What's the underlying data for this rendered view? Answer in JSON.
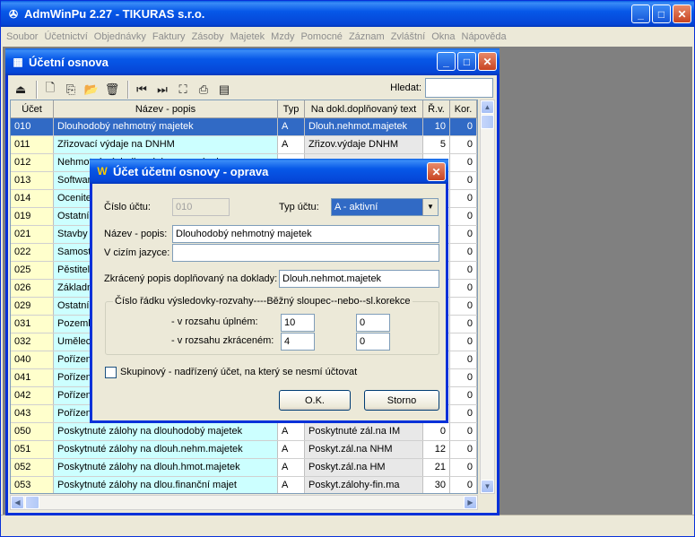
{
  "app": {
    "title": "AdmWinPu 2.27 - TIKURAS s.r.o.",
    "menu": [
      "Soubor",
      "Účetnictví",
      "Objednávky",
      "Faktury",
      "Zásoby",
      "Majetek",
      "Mzdy",
      "Pomocné",
      "Záznam",
      "Zvláštní",
      "Okna",
      "Nápověda"
    ]
  },
  "child": {
    "title": "Účetní osnova",
    "search_label": "Hledat:",
    "search_value": "",
    "columns": [
      "Účet",
      "Název - popis",
      "Typ",
      "Na dokl.doplňovaný text",
      "Ř.v.",
      "Kor."
    ],
    "rows": [
      {
        "ucet": "010",
        "nazev": "Dlouhodobý nehmotný majetek",
        "typ": "A",
        "text": "Dlouh.nehmot.majetek",
        "rv": "10",
        "kor": "0"
      },
      {
        "ucet": "011",
        "nazev": "Zřizovací výdaje na DNHM",
        "typ": "A",
        "text": "Zřizov.výdaje DNHM",
        "rv": "5",
        "kor": "0"
      },
      {
        "ucet": "012",
        "nazev": "Nehmotné výsledky výzkumu a vývoje",
        "typ": "",
        "text": "",
        "rv": "",
        "kor": "0"
      },
      {
        "ucet": "013",
        "nazev": "Software",
        "typ": "",
        "text": "",
        "rv": "",
        "kor": "0"
      },
      {
        "ucet": "014",
        "nazev": "Ocenitelná práva",
        "typ": "",
        "text": "",
        "rv": "",
        "kor": "0"
      },
      {
        "ucet": "019",
        "nazev": "Ostatní dlouhodobý nehmotný majetek",
        "typ": "",
        "text": "",
        "rv": "",
        "kor": "0"
      },
      {
        "ucet": "021",
        "nazev": "Stavby",
        "typ": "",
        "text": "",
        "rv": "",
        "kor": "0"
      },
      {
        "ucet": "022",
        "nazev": "Samostatné movité věci",
        "typ": "",
        "text": "",
        "rv": "",
        "kor": "0"
      },
      {
        "ucet": "025",
        "nazev": "Pěstitelské celky",
        "typ": "",
        "text": "",
        "rv": "",
        "kor": "0"
      },
      {
        "ucet": "026",
        "nazev": "Základní stádo",
        "typ": "",
        "text": "",
        "rv": "",
        "kor": "0"
      },
      {
        "ucet": "029",
        "nazev": "Ostatní dlouhodobý hmotný majetek",
        "typ": "",
        "text": "",
        "rv": "",
        "kor": "0"
      },
      {
        "ucet": "031",
        "nazev": "Pozemky",
        "typ": "",
        "text": "",
        "rv": "",
        "kor": "0"
      },
      {
        "ucet": "032",
        "nazev": "Umělecká díla",
        "typ": "",
        "text": "",
        "rv": "",
        "kor": "0"
      },
      {
        "ucet": "040",
        "nazev": "Pořízení",
        "typ": "",
        "text": "",
        "rv": "",
        "kor": "0"
      },
      {
        "ucet": "041",
        "nazev": "Pořízení",
        "typ": "",
        "text": "",
        "rv": "",
        "kor": "0"
      },
      {
        "ucet": "042",
        "nazev": "Pořízení",
        "typ": "",
        "text": "",
        "rv": "",
        "kor": "0"
      },
      {
        "ucet": "043",
        "nazev": "Pořízení",
        "typ": "",
        "text": "",
        "rv": "",
        "kor": "0"
      },
      {
        "ucet": "050",
        "nazev": "Poskytnuté zálohy na dlouhodobý majetek",
        "typ": "A",
        "text": "Poskytnuté zál.na IM",
        "rv": "0",
        "kor": "0"
      },
      {
        "ucet": "051",
        "nazev": "Poskytnuté zálohy na dlouh.nehm.majetek",
        "typ": "A",
        "text": "Poskyt.zál.na NHM",
        "rv": "12",
        "kor": "0"
      },
      {
        "ucet": "052",
        "nazev": "Poskytnuté zálohy na dlouh.hmot.majetek",
        "typ": "A",
        "text": "Poskyt.zál.na HM",
        "rv": "21",
        "kor": "0"
      },
      {
        "ucet": "053",
        "nazev": "Poskytnuté zálohy na dlou.finanční majet",
        "typ": "A",
        "text": "Poskyt.zálohy-fin.ma",
        "rv": "30",
        "kor": "0"
      }
    ]
  },
  "dialog": {
    "title": "Účet účetní osnovy - oprava",
    "cislo_uctu_label": "Číslo účtu:",
    "cislo_uctu_value": "010",
    "typ_uctu_label": "Typ účtu:",
    "typ_uctu_value": "A - aktivní",
    "nazev_label": "Název - popis:",
    "nazev_value": "Dlouhodobý nehmotný majetek",
    "cizi_label": "V cizím jazyce:",
    "cizi_value": "",
    "zkraceny_label": "Zkrácený popis doplňovaný na doklady:",
    "zkraceny_value": "Dlouh.nehmot.majetek",
    "group_title": "Číslo řádku výsledovky-rozvahy----Běžný sloupec--nebo--sl.korekce",
    "uplnem_label": "- v rozsahu úplném:",
    "uplnem_bezny": "10",
    "uplnem_korekce": "0",
    "zkracenem_label": "- v rozsahu zkráceném:",
    "zkracenem_bezny": "4",
    "zkracenem_korekce": "0",
    "skupinovy_label": "Skupinový - nadřízený účet, na který se nesmí účtovat",
    "ok_label": "O.K.",
    "storno_label": "Storno"
  }
}
